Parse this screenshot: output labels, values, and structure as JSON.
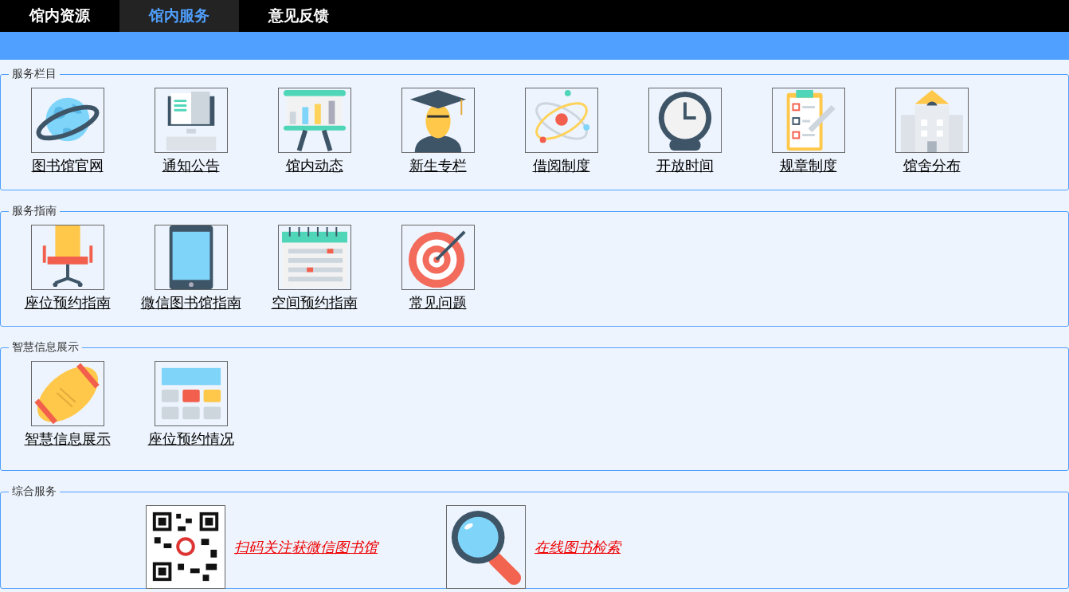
{
  "tabs": [
    {
      "label": "馆内资源",
      "selected": false
    },
    {
      "label": "馆内服务",
      "selected": true
    },
    {
      "label": "意见反馈",
      "selected": false
    }
  ],
  "sections": [
    {
      "title": "服务栏目",
      "kind": "grid",
      "items": [
        "图书馆官网",
        "通知公告",
        "馆内动态",
        "新生专栏",
        "借阅制度",
        "开放时间",
        "规章制度",
        "馆舍分布"
      ]
    },
    {
      "title": "服务指南",
      "kind": "grid",
      "items": [
        "座位预约指南",
        "微信图书馆指南",
        "空间预约指南",
        "常见问题"
      ]
    },
    {
      "title": "智慧信息展示",
      "kind": "grid",
      "items": [
        "智慧信息展示",
        "座位预约情况"
      ]
    },
    {
      "title": "综合服务",
      "kind": "inline",
      "items": [
        "扫码关注获微信图书馆",
        "在线图书检索"
      ]
    }
  ]
}
